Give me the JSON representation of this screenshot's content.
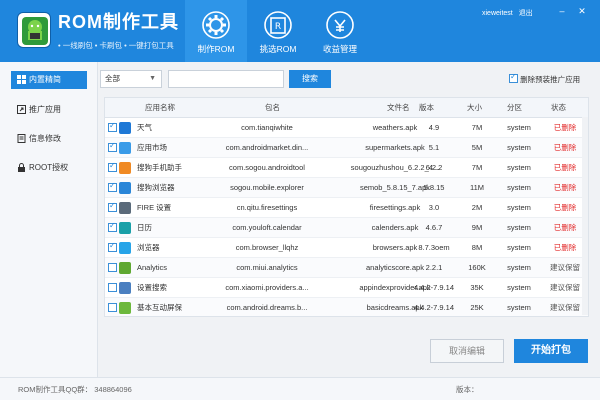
{
  "header": {
    "title": "ROM制作工具",
    "subtitle": "• 一线刷包  • 卡刷包  • 一键打包工具",
    "user": "xieweitest",
    "logout": "退出",
    "nav": [
      {
        "label": "制作ROM",
        "icon": "gear-icon"
      },
      {
        "label": "挑选ROM",
        "icon": "rom-card-icon"
      },
      {
        "label": "收益管理",
        "icon": "yen-icon"
      }
    ]
  },
  "sidebar": {
    "items": [
      {
        "label": "内置精简",
        "icon": "apps-icon"
      },
      {
        "label": "推广应用",
        "icon": "share-icon"
      },
      {
        "label": "信息修改",
        "icon": "document-icon"
      },
      {
        "label": "ROOT授权",
        "icon": "lock-icon"
      }
    ]
  },
  "toolbar": {
    "select_value": "全部",
    "search_placeholder": "",
    "search_label": "搜索",
    "delete_preinstall_label": "删除预装推广应用"
  },
  "table": {
    "headers": [
      "应用名称",
      "包名",
      "文件名",
      "版本",
      "大小",
      "分区",
      "状态"
    ],
    "rows": [
      {
        "checked": true,
        "name": "天气",
        "pkg": "com.tianqiwhite",
        "file": "weathers.apk",
        "ver": "4.9",
        "size": "7M",
        "part": "system",
        "status": "已删除",
        "status_color": "#e22727",
        "icon_color": "#1e78d6"
      },
      {
        "checked": true,
        "name": "应用市场",
        "pkg": "com.androidmarket.din...",
        "file": "supermarkets.apk",
        "ver": "5.1",
        "size": "5M",
        "part": "system",
        "status": "已删除",
        "status_color": "#e22727",
        "icon_color": "#3a9be8"
      },
      {
        "checked": true,
        "name": "搜狗手机助手",
        "pkg": "com.sogou.androidtool",
        "file": "sougouzhushou_6.2.2_4...",
        "ver": "6.2.2",
        "size": "7M",
        "part": "system",
        "status": "已删除",
        "status_color": "#e22727",
        "icon_color": "#f08a24"
      },
      {
        "checked": true,
        "name": "搜狗浏览器",
        "pkg": "sogou.mobile.explorer",
        "file": "semob_5.8.15_7.apk",
        "ver": "5.8.15",
        "size": "11M",
        "part": "system",
        "status": "已删除",
        "status_color": "#e22727",
        "icon_color": "#2a86d8"
      },
      {
        "checked": true,
        "name": "FIRE 设置",
        "pkg": "cn.qitu.firesettings",
        "file": "firesettings.apk",
        "ver": "3.0",
        "size": "2M",
        "part": "system",
        "status": "已删除",
        "status_color": "#e22727",
        "icon_color": "#5a6a7a"
      },
      {
        "checked": true,
        "name": "日历",
        "pkg": "com.youloft.calendar",
        "file": "calenders.apk",
        "ver": "4.6.7",
        "size": "9M",
        "part": "system",
        "status": "已删除",
        "status_color": "#e22727",
        "icon_color": "#1aa0a8"
      },
      {
        "checked": true,
        "name": "浏览器",
        "pkg": "com.browser_llqhz",
        "file": "browsers.apk",
        "ver": "8.7.3oem",
        "size": "8M",
        "part": "system",
        "status": "已删除",
        "status_color": "#e22727",
        "icon_color": "#27a4e8"
      },
      {
        "checked": false,
        "name": "Analytics",
        "pkg": "com.miui.analytics",
        "file": "analyticscore.apk",
        "ver": "2.2.1",
        "size": "160K",
        "part": "system",
        "status": "建议保留",
        "status_color": "#555555",
        "icon_color": "#5fa832"
      },
      {
        "checked": false,
        "name": "设置搜索",
        "pkg": "com.xiaomi.providers.a...",
        "file": "appindexprovider.apk",
        "ver": "4.4.2-7.9.14",
        "size": "35K",
        "part": "system",
        "status": "建议保留",
        "status_color": "#555555",
        "icon_color": "#4a7fc0"
      },
      {
        "checked": false,
        "name": "基本互动屏保",
        "pkg": "com.android.dreams.b...",
        "file": "basicdreams.apk",
        "ver": "4.4.2-7.9.14",
        "size": "25K",
        "part": "system",
        "status": "建议保留",
        "status_color": "#555555",
        "icon_color": "#6cb83c"
      }
    ]
  },
  "actions": {
    "cancel_label": "取消编辑",
    "start_label": "开始打包"
  },
  "footer": {
    "qq": "ROM制作工具QQ群： 348864096",
    "version": "版本："
  }
}
